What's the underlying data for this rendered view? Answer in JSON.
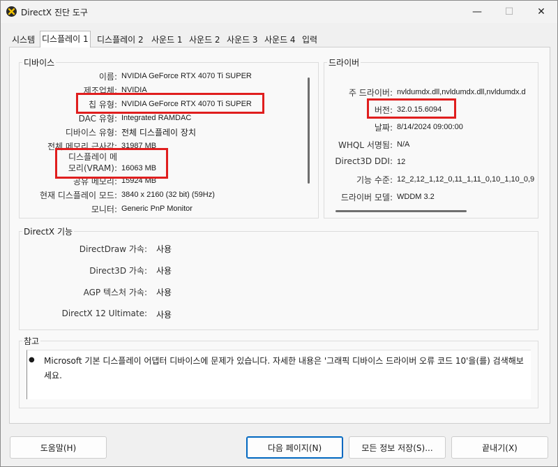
{
  "window": {
    "title": "DirectX 진단 도구",
    "minimize": "—",
    "maximize": "☐",
    "close": "✕"
  },
  "tabs": [
    "시스템",
    "디스플레이 1",
    "디스플레이 2",
    "사운드 1",
    "사운드 2",
    "사운드 3",
    "사운드 4",
    "입력"
  ],
  "device": {
    "group_label": "디바이스",
    "rows": [
      {
        "label": "이름:",
        "value": "NVIDIA GeForce RTX 4070 Ti SUPER"
      },
      {
        "label": "제조업체:",
        "value": "NVIDIA"
      },
      {
        "label": "칩 유형:",
        "value": "NVIDIA GeForce RTX 4070 Ti SUPER"
      },
      {
        "label": "DAC 유형:",
        "value": "Integrated RAMDAC"
      },
      {
        "label": "디바이스 유형:",
        "value": "전체 디스플레이 장치"
      },
      {
        "label": "전체 메모리 근사값:",
        "value": "31987 MB"
      },
      {
        "label_line1": "디스플레이 메",
        "label_line2": "모리(VRAM):",
        "value": "16063 MB"
      },
      {
        "label": "공유 메모리:",
        "value": "15924 MB"
      },
      {
        "label": "현재 디스플레이 모드:",
        "value": "3840 x 2160 (32 bit) (59Hz)"
      },
      {
        "label": "모니터:",
        "value": "Generic PnP Monitor"
      }
    ]
  },
  "driver": {
    "group_label": "드라이버",
    "rows": [
      {
        "label": "주 드라이버:",
        "value": "nvldumdx.dll,nvldumdx.dll,nvldumdx.d"
      },
      {
        "label": "버전:",
        "value": "32.0.15.6094"
      },
      {
        "label": "날짜:",
        "value": "8/14/2024 09:00:00"
      },
      {
        "label": "WHQL 서명됨:",
        "value": "N/A"
      },
      {
        "label": "Direct3D DDI:",
        "value": "12"
      },
      {
        "label": "기능 수준:",
        "value": "12_2,12_1,12_0,11_1,11_0,10_1,10_0,9"
      },
      {
        "label": "드라이버 모델:",
        "value": "WDDM 3.2"
      }
    ]
  },
  "directx_features": {
    "group_label": "DirectX 기능",
    "rows": [
      {
        "label": "DirectDraw 가속:",
        "value": "사용"
      },
      {
        "label": "Direct3D 가속:",
        "value": "사용"
      },
      {
        "label": "AGP 텍스처 가속:",
        "value": "사용"
      },
      {
        "label": "DirectX 12 Ultimate:",
        "value": "사용"
      }
    ]
  },
  "notes": {
    "group_label": "참고",
    "text": "Microsoft 기본 디스플레이 어댑터 디바이스에 문제가 있습니다. 자세한 내용은 '그래픽 디바이스 드라이버 오류 코드 10'을(를) 검색해보세요."
  },
  "buttons": {
    "help": "도움말(H)",
    "next_page": "다음 페이지(N)",
    "save_all": "모든 정보 저장(S)...",
    "exit": "끝내기(X)"
  },
  "colors": {
    "highlight": "#e01e1e",
    "default_button_border": "#0067c0"
  }
}
